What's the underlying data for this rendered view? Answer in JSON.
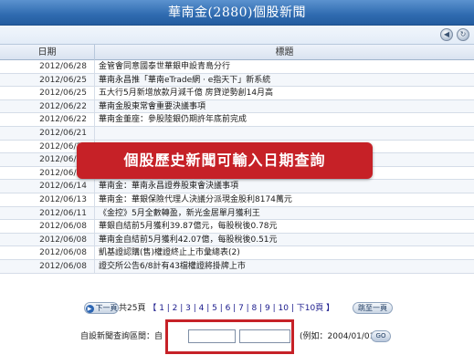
{
  "header": {
    "title": "華南金(2880)個股新聞",
    "icons": [
      "back-icon",
      "refresh-icon"
    ]
  },
  "table": {
    "col_date": "日期",
    "col_title": "標題",
    "rows": [
      {
        "date": "2012/06/28",
        "title": "金管會同意國泰世華銀申設青島分行"
      },
      {
        "date": "2012/06/25",
        "title": "華南永昌推「華南eTrade網 · e指天下」新系統"
      },
      {
        "date": "2012/06/25",
        "title": "五大行5月新增放款月減千億 房貸逆勢創14月高"
      },
      {
        "date": "2012/06/22",
        "title": "華南金股東常會重要決議事項"
      },
      {
        "date": "2012/06/22",
        "title": "華南金董座：參股陸銀仍期許年底前完成"
      },
      {
        "date": "2012/06/21",
        "title": ""
      },
      {
        "date": "2012/06/20",
        "title": ""
      },
      {
        "date": "2012/06/19",
        "title": ""
      },
      {
        "date": "2012/06/18",
        "title": "華南永昌推「華南eTrade網 · e指天下」新系統"
      },
      {
        "date": "2012/06/14",
        "title": "華南金：華南永昌證券股東會決議事項"
      },
      {
        "date": "2012/06/13",
        "title": "華南金：華銀保險代理人決議分派現金股利8174萬元"
      },
      {
        "date": "2012/06/11",
        "title": "《金控》5月全數轉盈，新光金居單月獲利王"
      },
      {
        "date": "2012/06/08",
        "title": "華銀自結前5月獲利39.87億元，每股稅後0.78元"
      },
      {
        "date": "2012/06/08",
        "title": "華南金自結前5月獲利42.07億，每股稅後0.51元"
      },
      {
        "date": "2012/06/08",
        "title": "凱基證認購(售)權證終止上市彙總表(2)"
      },
      {
        "date": "2012/06/08",
        "title": "證交所公告6/8計有43檔權證將掛牌上市"
      }
    ]
  },
  "overlay": {
    "banner_text": "個股歷史新聞可輸入日期查詢"
  },
  "pager": {
    "next_label": "下一頁",
    "summary": "共25頁",
    "pages": "【 1 | 2 | 3 | 4 | 5 | 6 | 7 | 8 | 9 | 10 | 下10頁 】",
    "prev_label": "跳至一頁"
  },
  "search": {
    "label": "自設新聞查詢區間：自",
    "to_label": "到",
    "hint": "(例如：2004/01/01)",
    "from_value": "",
    "to_value": "",
    "go_label": "GO"
  },
  "colors": {
    "title_bar": "#2f6bb0",
    "highlight": "#c62127"
  }
}
